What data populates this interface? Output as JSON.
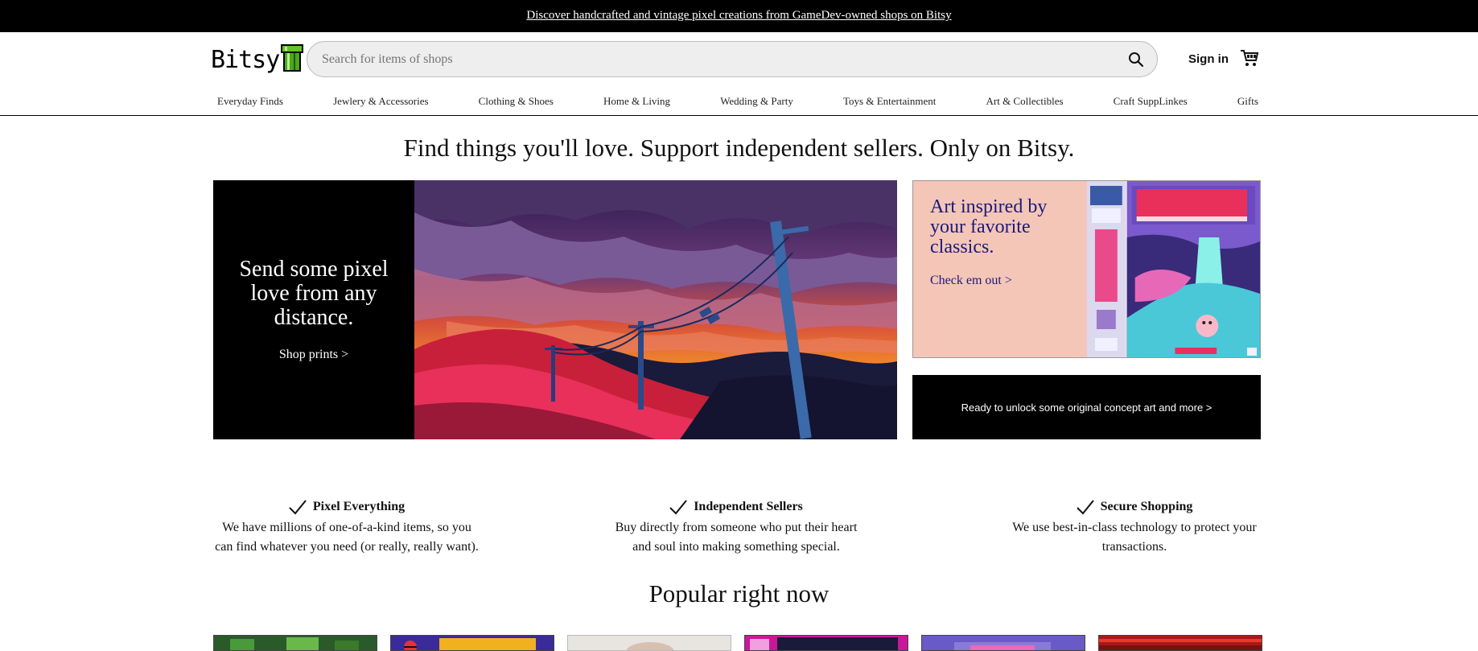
{
  "promo": {
    "text": "Discover handcrafted and vintage pixel creations from GameDev-owned shops on Bitsy"
  },
  "header": {
    "logo_text": "Bitsy",
    "search_placeholder": "Search for items of shops",
    "sign_in": "Sign in",
    "icons": {
      "search": "search-icon",
      "cart": "cart-icon",
      "logo": "pipe-logo-icon"
    }
  },
  "categories": [
    "Everyday Finds",
    "Jewlery & Accessories",
    "Clothing & Shoes",
    "Home & Living",
    "Wedding & Party",
    "Toys & Entertainment",
    "Art & Collectibles",
    "Craft SuppLinkes",
    "Gifts"
  ],
  "tagline": "Find things you'll love. Support independent sellers. Only on Bitsy.",
  "hero": {
    "heading": "Send some pixel love from any distance.",
    "link": "Shop prints >"
  },
  "side_promo": {
    "heading": "Art inspired by your favorite classics.",
    "link": "Check em out >"
  },
  "cta": "Ready to unlock some original concept art and more >",
  "features": [
    {
      "title": "Pixel Everything",
      "desc": "We have millions of one-of-a-kind items, so you can find whatever you need (or really, really want)."
    },
    {
      "title": "Independent Sellers",
      "desc": "Buy directly from someone who put their heart and soul into making something special."
    },
    {
      "title": "Secure Shopping",
      "desc": "We use best-in-class technology to protect your transactions."
    }
  ],
  "popular": {
    "title": "Popular right now"
  },
  "colors": {
    "promo_bg": "#000000",
    "side_promo_bg": "#f4c6b8",
    "side_promo_text": "#1a1a7a"
  }
}
